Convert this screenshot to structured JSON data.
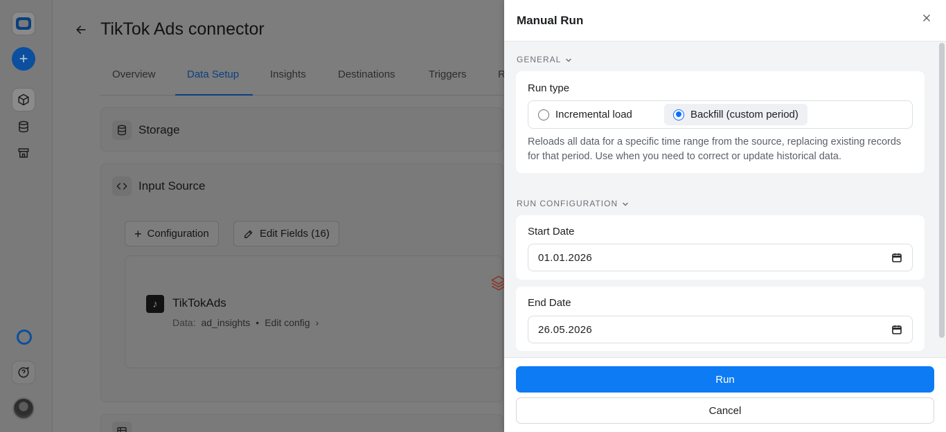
{
  "page": {
    "back_icon": "arrow-left-icon",
    "title": "TikTok Ads connector",
    "tabs": [
      {
        "label": "Overview"
      },
      {
        "label": "Data Setup",
        "active": true
      },
      {
        "label": "Insights"
      },
      {
        "label": "Destinations"
      },
      {
        "label": "Triggers"
      },
      {
        "label": "R"
      }
    ],
    "storage": {
      "icon": "database-icon",
      "title": "Storage"
    },
    "input_source": {
      "icon": "code-icon",
      "title": "Input Source",
      "configuration_button": "Configuration",
      "edit_fields_button": "Edit Fields (16)",
      "source": {
        "icon": "tiktok-icon",
        "name": "TikTokAds",
        "data_label": "Data:",
        "data_value": "ad_insights",
        "separator": "•",
        "edit_config": "Edit config",
        "stack_icon": "layers-icon"
      }
    },
    "bottom_card_icon": "table-icon"
  },
  "rail": {
    "logo_icon": "app-logo-icon",
    "new_icon": "plus-icon",
    "nav": [
      {
        "icon": "cube-icon",
        "active": true
      },
      {
        "icon": "database-icon"
      },
      {
        "icon": "store-icon"
      }
    ],
    "status_icon": "circle-icon",
    "help_icon": "chat-help-icon",
    "avatar": "user-avatar"
  },
  "drawer": {
    "title": "Manual Run",
    "close_icon": "close-icon",
    "general": {
      "label": "GENERAL",
      "run_type_label": "Run type",
      "options": [
        {
          "label": "Incremental load",
          "checked": false
        },
        {
          "label": "Backfill (custom period)",
          "checked": true
        }
      ],
      "help": "Reloads all data for a specific time range from the source, replacing existing records for that period. Use when you need to correct or update historical data."
    },
    "run_configuration": {
      "label": "RUN CONFIGURATION",
      "start_label": "Start Date",
      "start_value": "01.01.2026",
      "end_label": "End Date",
      "end_value": "26.05.2026"
    },
    "run_button": "Run",
    "cancel_button": "Cancel"
  },
  "colors": {
    "primary": "#0d7bf3",
    "active_tab": "#0b3f82",
    "overlay_bg": "#7d7d7d",
    "drawer_bg": "#f3f4f6"
  }
}
